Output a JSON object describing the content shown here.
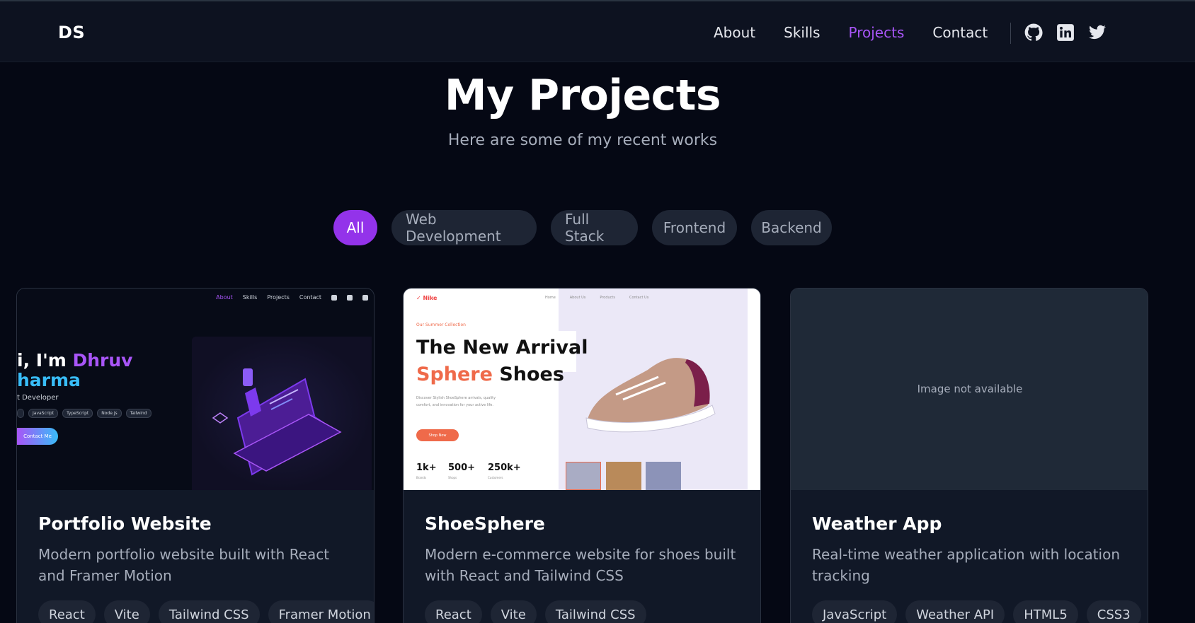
{
  "nav": {
    "logo": "DS",
    "links": [
      "About",
      "Skills",
      "Projects",
      "Contact"
    ],
    "active": "Projects",
    "social_icons": [
      "github-icon",
      "linkedin-icon",
      "twitter-icon"
    ]
  },
  "hero": {
    "title": "My Projects",
    "subtitle": "Here are some of my recent works"
  },
  "filters": {
    "items": [
      "All",
      "Web Development",
      "Full Stack",
      "Frontend",
      "Backend"
    ],
    "active": "All"
  },
  "colors": {
    "accent": "#9333ea",
    "accent_text": "#a855f7",
    "background": "#050814",
    "card": "#111827"
  },
  "projects": [
    {
      "title": "Portfolio Website",
      "description": "Modern portfolio website built with React and Framer Motion",
      "tags": [
        "React",
        "Vite",
        "Tailwind CSS",
        "Framer Motion"
      ],
      "thumbnail": {
        "nav": [
          "About",
          "Skills",
          "Projects",
          "Contact"
        ],
        "greeting_part1": "i, I'm ",
        "greeting_name": "Dhruv",
        "greeting_part2": "harma",
        "role": "t Developer",
        "pills": [
          "JavaScript",
          "TypeScript",
          "Node.js",
          "Tailwind"
        ],
        "button": "Contact Me"
      }
    },
    {
      "title": "ShoeSphere",
      "description": "Modern e-commerce website for shoes built with React and Tailwind CSS",
      "tags": [
        "React",
        "Vite",
        "Tailwind CSS"
      ],
      "thumbnail": {
        "logo": "Nike",
        "nav": [
          "Home",
          "About Us",
          "Products",
          "Contact Us"
        ],
        "kicker": "Our Summer Collection",
        "heading1": "The New Arrival",
        "heading2_red": "Sphere",
        "heading2_rest": " Shoes",
        "paragraph": "Discover Stylish ShoeSphere arrivals, quality comfort, and innovation for your active life.",
        "button": "Shop Now",
        "stats": [
          {
            "value": "1k+",
            "label": "Brands"
          },
          {
            "value": "500+",
            "label": "Shops"
          },
          {
            "value": "250k+",
            "label": "Customers"
          }
        ]
      }
    },
    {
      "title": "Weather App",
      "description": "Real-time weather application with location tracking",
      "tags": [
        "JavaScript",
        "Weather API",
        "HTML5",
        "CSS3"
      ],
      "thumbnail": {
        "placeholder": "Image not available"
      }
    }
  ]
}
